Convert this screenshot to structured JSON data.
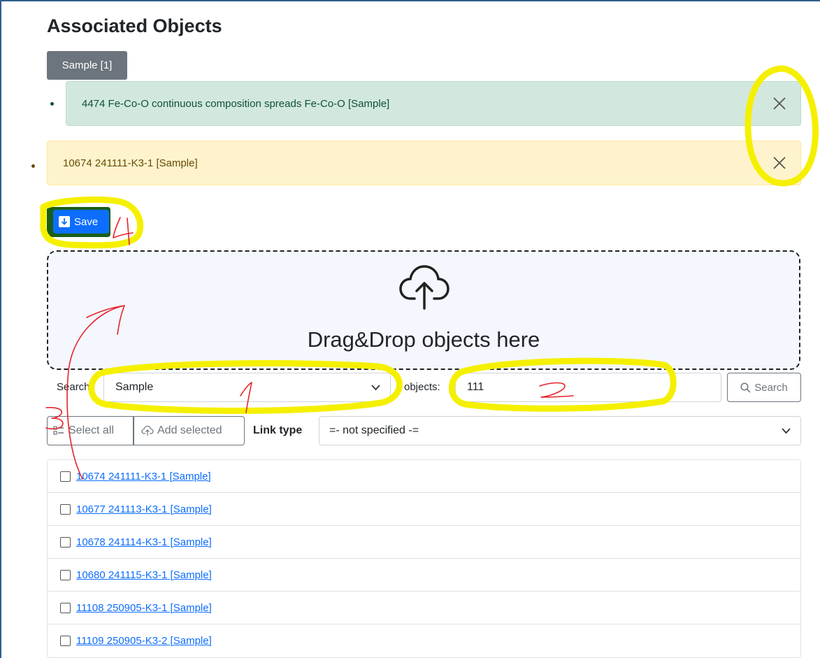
{
  "page": {
    "title": "Associated Objects"
  },
  "tabs": [
    {
      "label": "Sample [1]"
    }
  ],
  "associated": [
    {
      "text": "4474 Fe-Co-O continuous composition spreads Fe-Co-O [Sample]",
      "style": "success",
      "close": "×"
    },
    {
      "text": "10674 241111-K3-1 [Sample]",
      "style": "warning",
      "close": "×"
    }
  ],
  "save": {
    "label": "Save",
    "icon": "download-icon"
  },
  "dropzone": {
    "text": "Drag&Drop objects here",
    "icon": "cloud-upload-icon"
  },
  "search": {
    "label": "Search",
    "type_value": "Sample",
    "objects_label": "objects:",
    "objects_value": "111",
    "button_label": "Search"
  },
  "toolbar": {
    "select_all": "Select all",
    "add_selected": "Add selected",
    "link_type_label": "Link type",
    "link_type_value": "=- not specified -="
  },
  "results": [
    {
      "label": "10674 241111-K3-1 [Sample]"
    },
    {
      "label": "10677 241113-K3-1 [Sample]"
    },
    {
      "label": "10678 241114-K3-1 [Sample]"
    },
    {
      "label": "10680 241115-K3-1 [Sample]"
    },
    {
      "label": "11108 250905-K3-1 [Sample]"
    },
    {
      "label": "11109 250905-K3-2 [Sample]"
    }
  ],
  "annotations": {
    "n1": "1",
    "n2": "2",
    "n3": "3",
    "n4": "4"
  },
  "colors": {
    "highlight": "#f5f000",
    "pen": "#e5232b",
    "primary": "#0d6efd"
  }
}
